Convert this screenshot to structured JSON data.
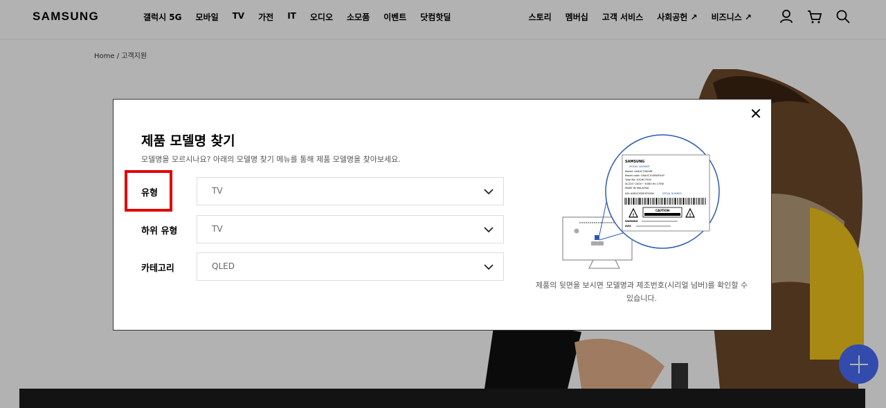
{
  "header": {
    "logo": "SAMSUNG",
    "nav": [
      "갤럭시 5G",
      "모바일",
      "TV",
      "가전",
      "IT",
      "오디오",
      "소모품",
      "이벤트",
      "닷컴핫딜"
    ],
    "nav_right": [
      "스토리",
      "멤버십",
      "고객 서비스",
      "사회공헌 ↗",
      "비즈니스 ↗"
    ],
    "icons": [
      "user-icon",
      "cart-icon",
      "search-icon"
    ]
  },
  "breadcrumb": "Home / 고객지원",
  "modal": {
    "title": "제품 모델명 찾기",
    "description": "모델명을 모르시나요? 아래의 모델명 찾기 메뉴를 통해 제품 모델명을 찾아보세요.",
    "rows": [
      {
        "label": "유형",
        "value": "TV"
      },
      {
        "label": "하위 유형",
        "value": "TV"
      },
      {
        "label": "카테고리",
        "value": "QLED"
      }
    ],
    "caption": "제품의 뒷면을 보시면 모델명과 제조번호(시리얼 넘버)를 확인할 수 있습니다.",
    "label_card": {
      "brand": "SAMSUNG",
      "model_tag": "MODEL NUMBER",
      "lines": [
        "Model: UA40C7000WF",
        "Model code: UA40C7000WFXXY",
        "Type No: UX16C7000",
        "AC220~240V~ 50/60 Hz 170W",
        "MADE IN MALAYSIA"
      ],
      "sn": "S/N: A0B1C2D3E4F5G6H",
      "serial_tag": "SERIAL NUMBER",
      "caution": "CAUTION",
      "warning": "WARNING",
      "avis": "AVIS"
    }
  },
  "colors": {
    "accent": "#e00000",
    "fab": "#4a6cf7",
    "ring": "#2a57b8"
  }
}
